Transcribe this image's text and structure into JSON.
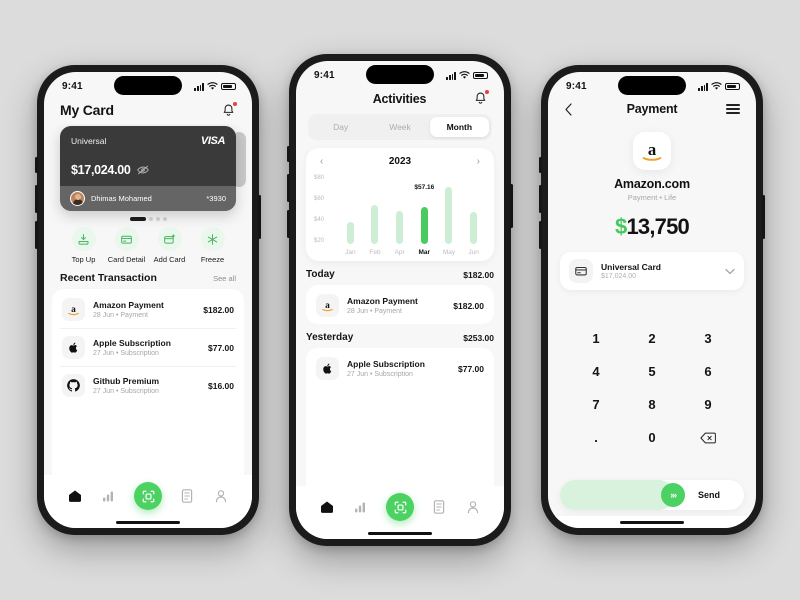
{
  "theme": {
    "accent": "#4cd263",
    "accent_soft": "#cdeed4",
    "bg": "#dcdcdc",
    "card_dark": "#3a3a3a",
    "alert": "#e8413c"
  },
  "phone1": {
    "status": {
      "time": "9:41"
    },
    "header": {
      "title": "My Card",
      "bell_icon": "bell-icon"
    },
    "card": {
      "brand_label": "Universal",
      "network": "VISA",
      "balance": "$17,024.00",
      "eye_icon": "eye-off-icon",
      "holder": "Dhimas Mohamed",
      "last4": "*3930",
      "dots": 4,
      "active_dot": 0
    },
    "quick_actions": [
      {
        "label": "Top Up",
        "icon": "top-up-icon"
      },
      {
        "label": "Card Detail",
        "icon": "card-detail-icon"
      },
      {
        "label": "Add Card",
        "icon": "add-card-icon"
      },
      {
        "label": "Freeze",
        "icon": "freeze-icon"
      }
    ],
    "section": {
      "title": "Recent Transaction",
      "link": "See all"
    },
    "transactions": [
      {
        "name": "Amazon Payment",
        "sub": "28 Jun • Payment",
        "amount": "$182.00",
        "icon": "amazon-icon"
      },
      {
        "name": "Apple Subscription",
        "sub": "27 Jun • Subscription",
        "amount": "$77.00",
        "icon": "apple-icon"
      },
      {
        "name": "Github Premium",
        "sub": "27 Jun • Subscription",
        "amount": "$16.00",
        "icon": "github-icon"
      }
    ],
    "nav": [
      {
        "name": "home",
        "icon": "home-icon",
        "active": true
      },
      {
        "name": "stats",
        "icon": "bar-chart-icon",
        "active": false
      },
      {
        "name": "scan",
        "icon": "scan-icon",
        "fab": true
      },
      {
        "name": "records",
        "icon": "list-icon",
        "active": false
      },
      {
        "name": "profile",
        "icon": "person-icon",
        "active": false
      }
    ]
  },
  "phone2": {
    "status": {
      "time": "9:41"
    },
    "header": {
      "back_icon": "chevron-left-icon",
      "title": "Activities",
      "bell_icon": "bell-icon"
    },
    "segments": [
      {
        "label": "Day",
        "active": false
      },
      {
        "label": "Week",
        "active": false
      },
      {
        "label": "Month",
        "active": true
      }
    ],
    "year_nav": {
      "prev_icon": "chevron-left-icon",
      "year": "2023",
      "next_icon": "chevron-right-icon"
    },
    "groups": [
      {
        "label": "Today",
        "total": "$182.00",
        "items": [
          {
            "name": "Amazon Payment",
            "sub": "28 Jun • Payment",
            "amount": "$182.00",
            "icon": "amazon-icon"
          }
        ]
      },
      {
        "label": "Yesterday",
        "total": "$253.00",
        "items": [
          {
            "name": "Apple Subscription",
            "sub": "27 Jun • Subscription",
            "amount": "$77.00",
            "icon": "apple-icon"
          }
        ]
      }
    ],
    "nav": [
      {
        "name": "home",
        "icon": "home-icon",
        "active": true
      },
      {
        "name": "stats",
        "icon": "bar-chart-icon",
        "active": false
      },
      {
        "name": "scan",
        "icon": "scan-icon",
        "fab": true
      },
      {
        "name": "records",
        "icon": "list-icon",
        "active": false
      },
      {
        "name": "profile",
        "icon": "person-icon",
        "active": false
      }
    ]
  },
  "phone3": {
    "status": {
      "time": "9:41"
    },
    "header": {
      "back_icon": "chevron-left-icon",
      "title": "Payment",
      "menu_icon": "hamburger-icon"
    },
    "merchant": {
      "logo_icon": "amazon-icon",
      "name": "Amazon.com",
      "subtitle": "Payment • Life"
    },
    "amount": {
      "currency": "$",
      "value": "13,750"
    },
    "card_selector": {
      "icon": "credit-card-icon",
      "name": "Universal Card",
      "balance": "$17,024.00",
      "chevron_icon": "chevron-down-icon"
    },
    "keypad": [
      "1",
      "2",
      "3",
      "4",
      "5",
      "6",
      "7",
      "8",
      "9",
      ".",
      "0",
      "⌫"
    ],
    "slider": {
      "thumb_icon": "chevrons-right-icon",
      "thumb_glyph": "›››",
      "label": "Send"
    }
  },
  "chart_data": {
    "type": "bar",
    "title": "2023",
    "categories": [
      "Jan",
      "Feb",
      "Apr",
      "Mar",
      "May",
      "Jun"
    ],
    "values": [
      28,
      50,
      42,
      47,
      72,
      40
    ],
    "highlight_index": 3,
    "annotation": {
      "index": 3,
      "text": "$57.16"
    },
    "ylabel": "",
    "xlabel": "",
    "ylim": [
      0,
      90
    ],
    "yticks": [
      "$80",
      "$60",
      "$40",
      "$20"
    ],
    "grid": false,
    "legend": "none"
  }
}
